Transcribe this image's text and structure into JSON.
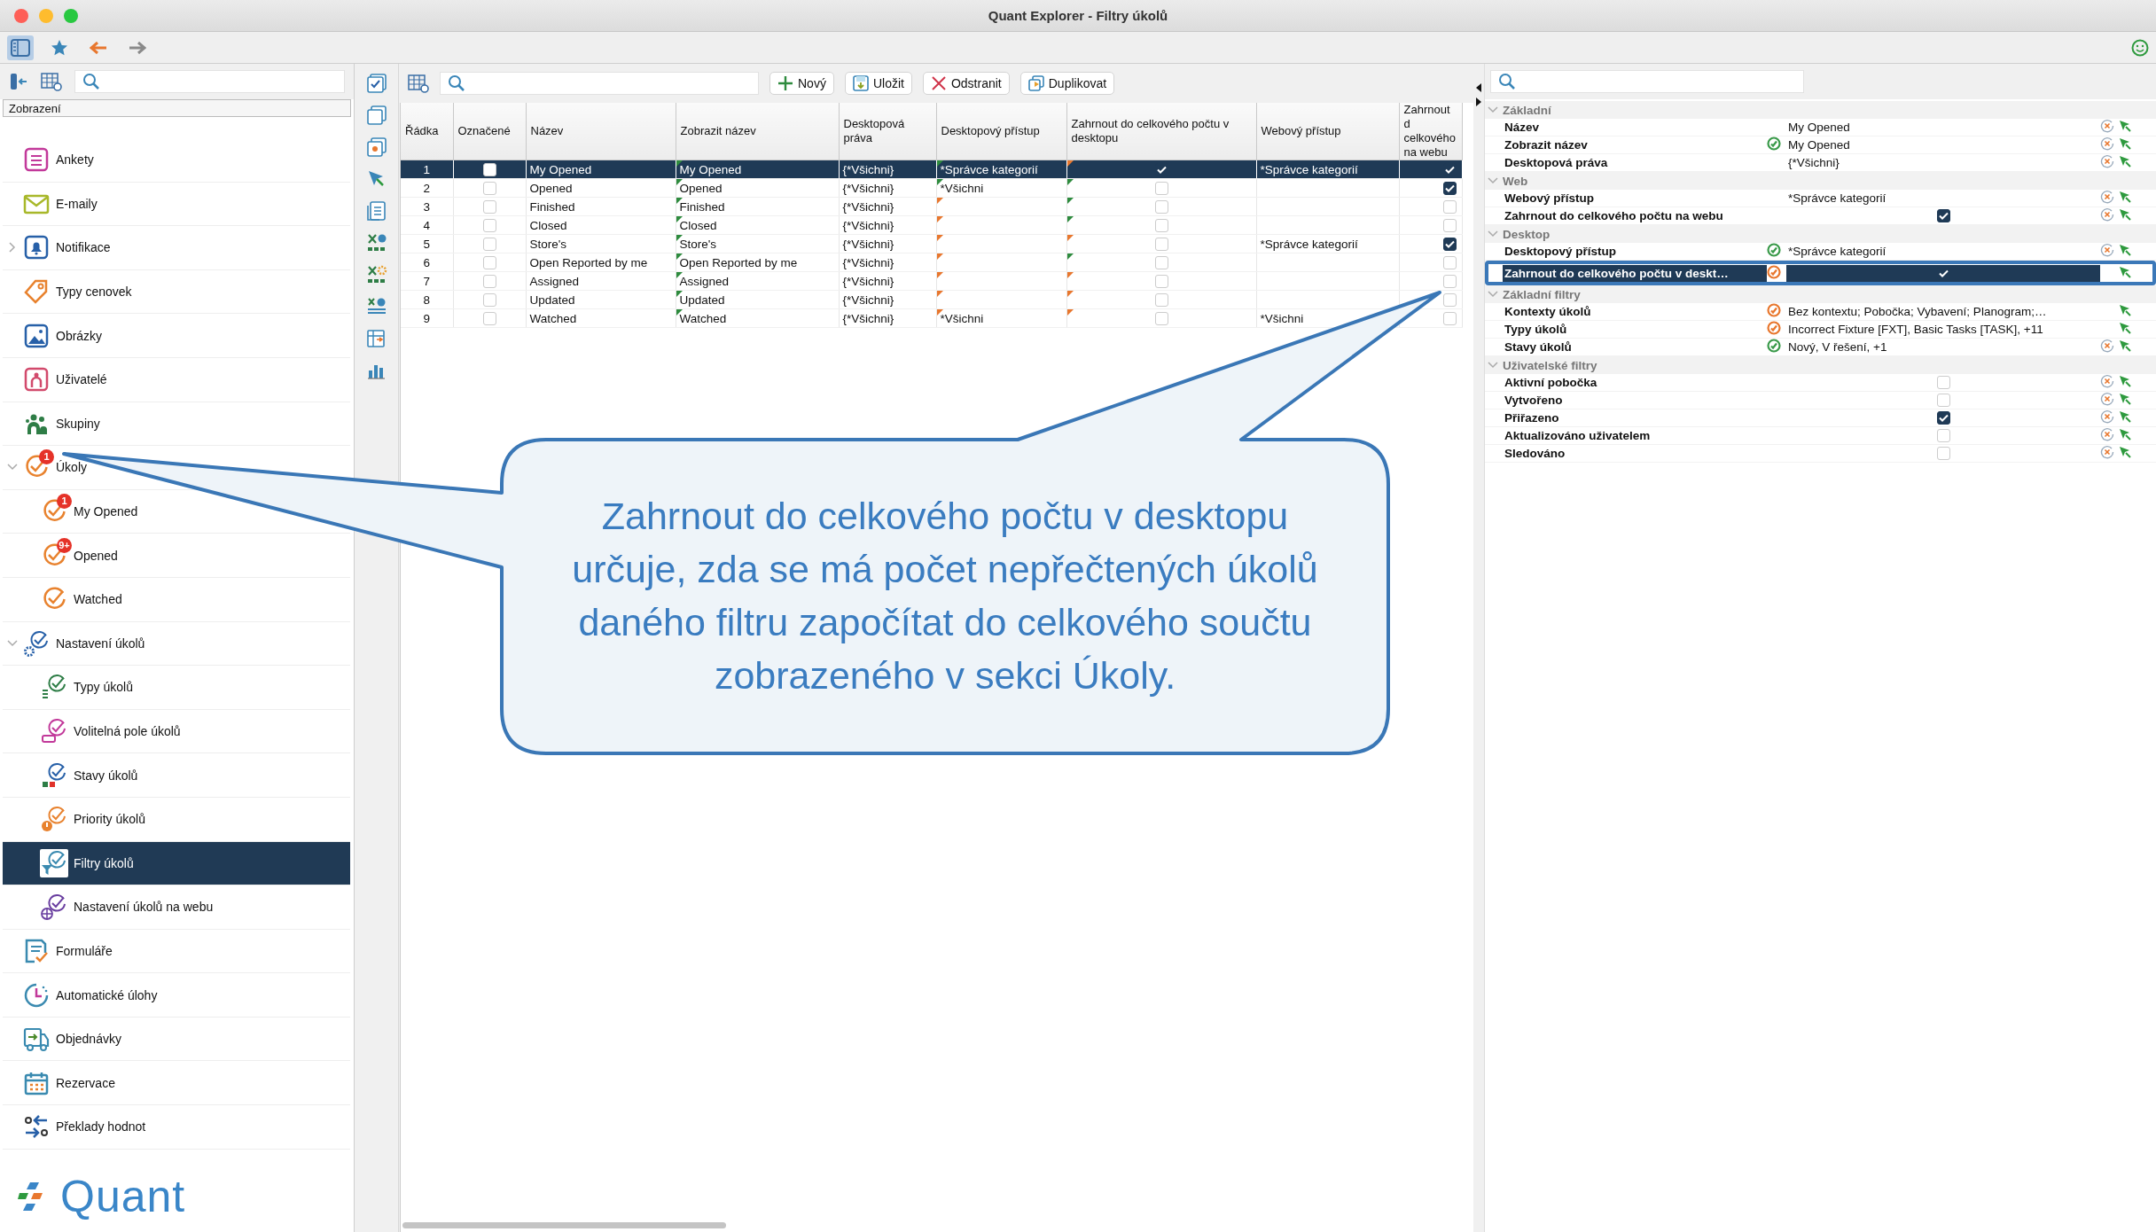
{
  "window": {
    "title": "Quant Explorer - Filtry úkolů"
  },
  "toolbar": {
    "items": [
      {
        "kind": "sidebar-toggle",
        "selected": true
      },
      {
        "kind": "star",
        "selected": false
      },
      {
        "kind": "back",
        "disabled": false
      },
      {
        "kind": "forward",
        "disabled": true
      }
    ]
  },
  "sidebar": {
    "header": "Zobrazení",
    "logo": "Quant",
    "items": [
      {
        "label": "Ankety",
        "selected": false
      },
      {
        "label": "E-maily",
        "selected": false
      },
      {
        "label": "Notifikace",
        "expanded": false,
        "selected": false
      },
      {
        "label": "Typy cenovek",
        "selected": false
      },
      {
        "label": "Obrázky",
        "selected": false
      },
      {
        "label": "Uživatelé",
        "selected": false
      },
      {
        "label": "Skupiny",
        "selected": false
      },
      {
        "label": "Úkoly",
        "expanded": true,
        "badge": "1",
        "selected": false,
        "children": [
          {
            "label": "My Opened",
            "badge": "1",
            "selected": false
          },
          {
            "label": "Opened",
            "badge": "9+",
            "selected": false
          },
          {
            "label": "Watched",
            "selected": false
          }
        ]
      },
      {
        "label": "Nastavení úkolů",
        "expanded": true,
        "selected": false,
        "children": [
          {
            "label": "Typy úkolů",
            "selected": false
          },
          {
            "label": "Volitelná pole úkolů",
            "selected": false
          },
          {
            "label": "Stavy úkolů",
            "selected": false
          },
          {
            "label": "Priority úkolů",
            "selected": false
          },
          {
            "label": "Filtry úkolů",
            "selected": true
          },
          {
            "label": "Nastavení úkolů na webu",
            "selected": false
          }
        ]
      },
      {
        "label": "Formuláře",
        "selected": false
      },
      {
        "label": "Automatické úlohy",
        "selected": false
      },
      {
        "label": "Objednávky",
        "selected": false
      },
      {
        "label": "Rezervace",
        "selected": false
      },
      {
        "label": "Překlady hodnot",
        "selected": false
      }
    ]
  },
  "table": {
    "buttons": [
      "Nový",
      "Uložit",
      "Odstranit",
      "Duplikovat"
    ],
    "columns": [
      "Řádka",
      "Označené",
      "Název",
      "Zobrazit název",
      "Desktopová práva",
      "Desktopový přístup",
      "Zahrnout do celkového počtu v desktopu",
      "Webový přístup",
      "Zahrnout d\ncelkového\nna webu"
    ],
    "rows": [
      {
        "row": "1",
        "marked": false,
        "name": "My Opened",
        "display_name": "My Opened",
        "display_name_marker": {
          "color": "#2e8b3e"
        },
        "desktop_rights": "{*Všichni}",
        "desktop_access": "*Správce kategorií",
        "desktop_access_marker": {
          "color": "#2e8b3e"
        },
        "include_desktop": true,
        "include_desktop_marker": {
          "color": "#e8772e"
        },
        "web_access": "*Správce kategorií",
        "include_web": true,
        "selected": true
      },
      {
        "row": "2",
        "marked": false,
        "name": "Opened",
        "display_name": "Opened",
        "display_name_marker": {
          "color": "#2e8b3e"
        },
        "desktop_rights": "{*Všichni}",
        "desktop_access": "*Všichni",
        "desktop_access_marker": {
          "color": "#2e8b3e"
        },
        "include_desktop": false,
        "include_desktop_marker": {
          "color": "#2e8b3e"
        },
        "include_web": true,
        "selected": false
      },
      {
        "row": "3",
        "marked": false,
        "name": "Finished",
        "display_name": "Finished",
        "display_name_marker": {
          "color": "#2e8b3e"
        },
        "desktop_rights": "{*Všichni}",
        "desktop_access_marker": {
          "color": "#e8772e"
        },
        "include_desktop": false,
        "include_desktop_marker": {
          "color": "#2e8b3e"
        },
        "include_web": false,
        "selected": false
      },
      {
        "row": "4",
        "marked": false,
        "name": "Closed",
        "display_name": "Closed",
        "display_name_marker": {
          "color": "#2e8b3e"
        },
        "desktop_rights": "{*Všichni}",
        "desktop_access_marker": {
          "color": "#e8772e"
        },
        "include_desktop": false,
        "include_desktop_marker": {
          "color": "#2e8b3e"
        },
        "include_web": false,
        "selected": false
      },
      {
        "row": "5",
        "marked": false,
        "name": "Store's",
        "display_name": "Store's",
        "display_name_marker": {
          "color": "#2e8b3e"
        },
        "desktop_rights": "{*Všichni}",
        "desktop_access_marker": {
          "color": "#e8772e"
        },
        "include_desktop": false,
        "include_desktop_marker": {
          "color": "#e8772e"
        },
        "web_access": "*Správce kategorií",
        "include_web": true,
        "selected": false
      },
      {
        "row": "6",
        "marked": false,
        "name": "Open Reported by me",
        "display_name": "Open Reported by me",
        "display_name_marker": {
          "color": "#2e8b3e"
        },
        "desktop_rights": "{*Všichni}",
        "desktop_access_marker": {
          "color": "#e8772e"
        },
        "include_desktop": false,
        "include_desktop_marker": {
          "color": "#2e8b3e"
        },
        "include_web": false,
        "selected": false
      },
      {
        "row": "7",
        "marked": false,
        "name": "Assigned",
        "display_name": "Assigned",
        "display_name_marker": {
          "color": "#2e8b3e"
        },
        "desktop_rights": "{*Všichni}",
        "desktop_access_marker": {
          "color": "#e8772e"
        },
        "include_desktop": false,
        "include_desktop_marker": {
          "color": "#e8772e"
        },
        "include_web": false,
        "selected": false
      },
      {
        "row": "8",
        "marked": false,
        "name": "Updated",
        "display_name": "Updated",
        "display_name_marker": {
          "color": "#2e8b3e"
        },
        "desktop_rights": "{*Všichni}",
        "desktop_access_marker": {
          "color": "#e8772e"
        },
        "include_desktop": false,
        "include_desktop_marker": {
          "color": "#e8772e"
        },
        "include_web": false,
        "selected": false
      },
      {
        "row": "9",
        "marked": false,
        "name": "Watched",
        "display_name": "Watched",
        "display_name_marker": {
          "color": "#2e8b3e"
        },
        "desktop_rights": "{*Všichni}",
        "desktop_access": "*Všichni",
        "desktop_access_marker": {
          "color": "#e8772e"
        },
        "include_desktop": false,
        "include_desktop_marker": {
          "color": "#e8772e"
        },
        "web_access": "*Všichni",
        "include_web": false,
        "selected": false
      }
    ]
  },
  "properties": {
    "groups": [
      {
        "title": "Základní",
        "expanded": true,
        "rows": [
          {
            "label": "Název",
            "kind": "text",
            "value": "My Opened",
            "resettable": true,
            "selected": false
          },
          {
            "label": "Zobrazit název",
            "kind": "text",
            "value": "My Opened",
            "color": "#3a9a4a",
            "resettable": true,
            "selected": false
          },
          {
            "label": "Desktopová práva",
            "kind": "text",
            "value": "{*Všichni}",
            "resettable": true,
            "selected": false
          }
        ]
      },
      {
        "title": "Web",
        "expanded": true,
        "rows": [
          {
            "label": "Webový přístup",
            "kind": "text",
            "value": "*Správce kategorií",
            "resettable": true,
            "selected": false
          },
          {
            "label": "Zahrnout do celkového počtu na webu",
            "kind": "checkbox",
            "checked": true,
            "resettable": true,
            "selected": false
          }
        ]
      },
      {
        "title": "Desktop",
        "expanded": true,
        "rows": [
          {
            "label": "Desktopový přístup",
            "kind": "text",
            "value": "*Správce kategorií",
            "color": "#3a9a4a",
            "resettable": true,
            "selected": false
          },
          {
            "label": "Zahrnout do celkového počtu v deskt…",
            "kind": "checkbox",
            "checked": true,
            "color": "#e8772e",
            "resettable": false,
            "selected": true
          }
        ]
      },
      {
        "title": "Základní filtry",
        "expanded": true,
        "rows": [
          {
            "label": "Kontexty úkolů",
            "kind": "text",
            "value": "Bez kontextu; Pobočka; Vybavení; Planogram;…",
            "color": "#e8772e",
            "resettable": false,
            "selected": false
          },
          {
            "label": "Typy úkolů",
            "kind": "text",
            "value": "Incorrect Fixture [FXT], Basic Tasks [TASK], +11",
            "color": "#e8772e",
            "resettable": false,
            "selected": false
          },
          {
            "label": "Stavy úkolů",
            "kind": "text",
            "value": "Nový, V řešení, +1",
            "color": "#3a9a4a",
            "resettable": true,
            "selected": false
          }
        ]
      },
      {
        "title": "Uživatelské filtry",
        "expanded": true,
        "rows": [
          {
            "label": "Aktivní pobočka",
            "kind": "checkbox",
            "checked": false,
            "resettable": true,
            "selected": false
          },
          {
            "label": "Vytvořeno",
            "kind": "checkbox",
            "checked": false,
            "resettable": true,
            "selected": false
          },
          {
            "label": "Přiřazeno",
            "kind": "checkbox",
            "checked": true,
            "resettable": true,
            "selected": false
          },
          {
            "label": "Aktualizováno uživatelem",
            "kind": "checkbox",
            "checked": false,
            "resettable": true,
            "selected": false
          },
          {
            "label": "Sledováno",
            "kind": "checkbox",
            "checked": false,
            "resettable": true,
            "selected": false
          }
        ]
      }
    ]
  },
  "callout": {
    "text": "Zahrnout do celkového počtu v desktopu určuje, zda se má počet nepřečtených úkolů daného filtru započítat do celkového součtu zobrazeného v sekci Úkoly."
  }
}
